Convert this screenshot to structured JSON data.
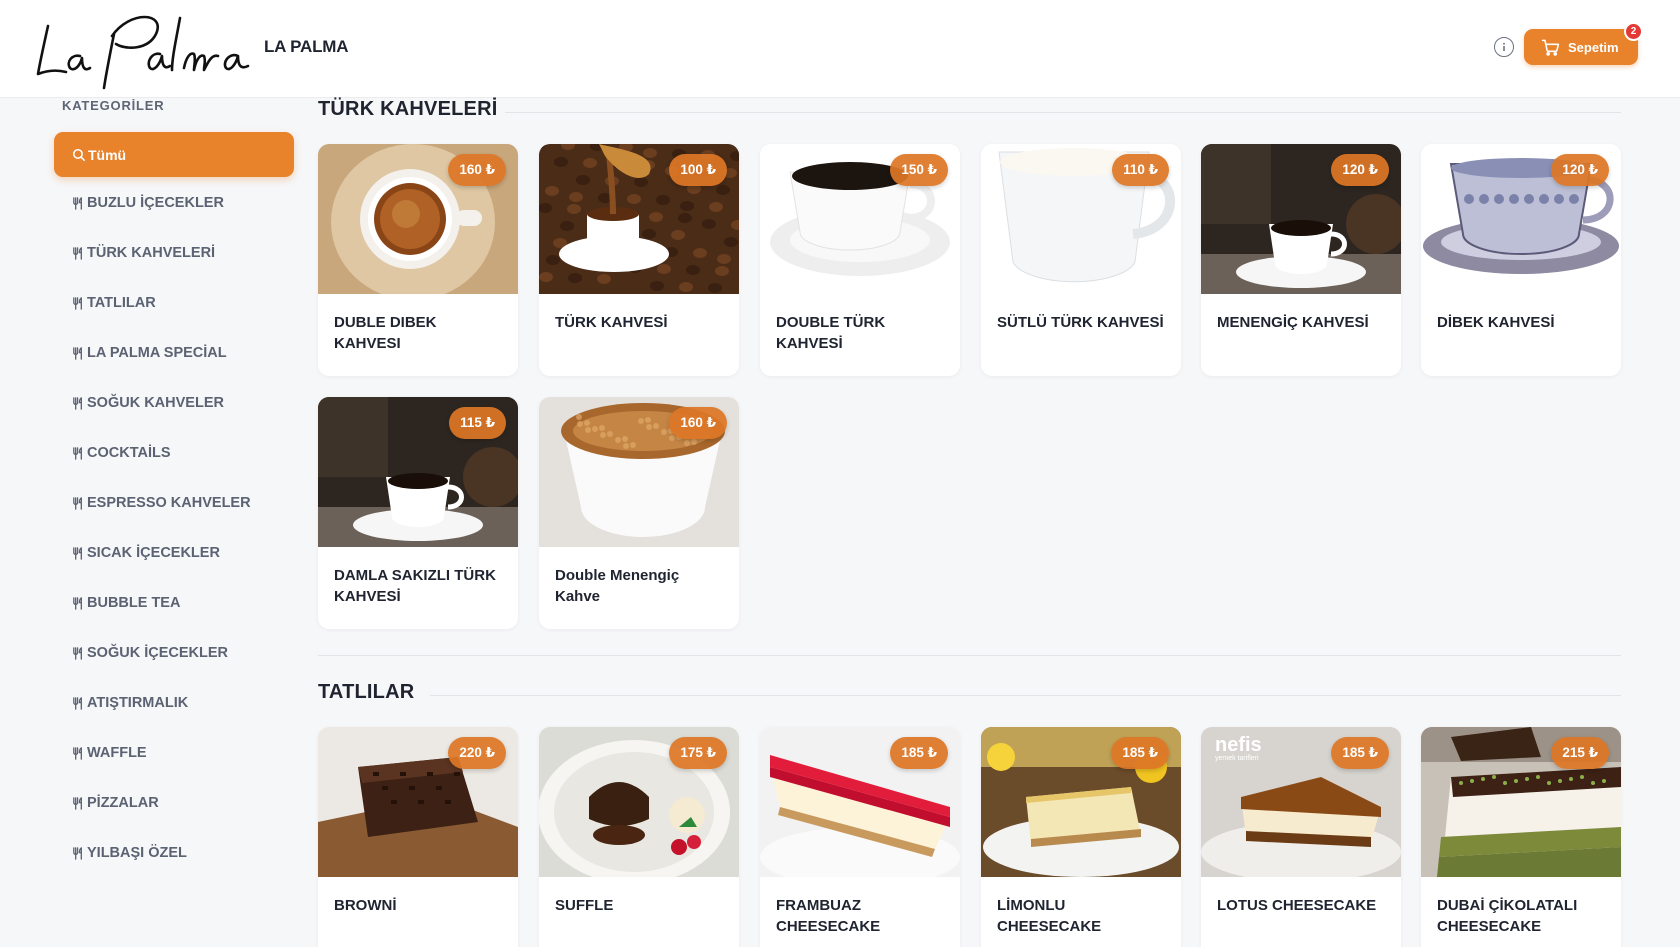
{
  "header": {
    "logo_text": "La Palma",
    "brand_name": "LA PALMA",
    "cart_label": "Sepetim",
    "cart_count": "2",
    "accent_color": "#e8822b",
    "icons": [
      "info-icon",
      "cart-icon"
    ]
  },
  "sidebar": {
    "heading": "KATEGORİLER",
    "active": "Tümü",
    "items": [
      "BUZLU İÇECEKLER",
      "TÜRK KAHVELERİ",
      "TATLILAR",
      "LA PALMA SPECİAL",
      "SOĞUK KAHVELER",
      "COCKTAİLS",
      "ESPRESSO KAHVELER",
      "SICAK İÇECEKLER",
      "BUBBLE TEA",
      "SOĞUK İÇECEKLER",
      "ATIŞTIRMALIK",
      "WAFFLE",
      "PİZZALAR",
      "YILBAŞI ÖZEL"
    ]
  },
  "sections": [
    {
      "title": "TÜRK KAHVELERİ",
      "products": [
        {
          "name": "DUBLE DIBEK KAHVESI",
          "price": "160 ₺",
          "image": "turkish-coffee-top"
        },
        {
          "name": "TÜRK KAHVESİ",
          "price": "100 ₺",
          "image": "coffee-pour-beans"
        },
        {
          "name": "DOUBLE TÜRK KAHVESİ",
          "price": "150 ₺",
          "image": "white-cup-saucer"
        },
        {
          "name": "SÜTLÜ TÜRK KAHVESİ",
          "price": "110 ₺",
          "image": "milk-cup"
        },
        {
          "name": "MENENGİÇ KAHVESİ",
          "price": "120 ₺",
          "image": "dark-table-coffee"
        },
        {
          "name": "DİBEK KAHVESİ",
          "price": "120 ₺",
          "image": "ornate-cup"
        },
        {
          "name": "DAMLA SAKIZLI TÜRK KAHVESİ",
          "price": "115 ₺",
          "image": "dark-table-coffee"
        },
        {
          "name": "Double Menengiç Kahve",
          "price": "160 ₺",
          "image": "foam-cup"
        }
      ]
    },
    {
      "title": "TATLILAR",
      "products": [
        {
          "name": "BROWNİ",
          "price": "220 ₺",
          "image": "brownie"
        },
        {
          "name": "SUFFLE",
          "price": "175 ₺",
          "image": "souffle"
        },
        {
          "name": "FRAMBUAZ CHEESECAKE",
          "price": "185 ₺",
          "image": "raspberry-cheesecake"
        },
        {
          "name": "LİMONLU CHEESECAKE",
          "price": "185 ₺",
          "image": "lemon-cheesecake"
        },
        {
          "name": "LOTUS CHEESECAKE",
          "price": "185 ₺",
          "image": "lotus-cheesecake",
          "watermark": "nefis yemek tarifleri"
        },
        {
          "name": "DUBAİ ÇİKOLATALI CHEESECAKE",
          "price": "215 ₺",
          "image": "dubai-cheesecake"
        }
      ]
    }
  ]
}
